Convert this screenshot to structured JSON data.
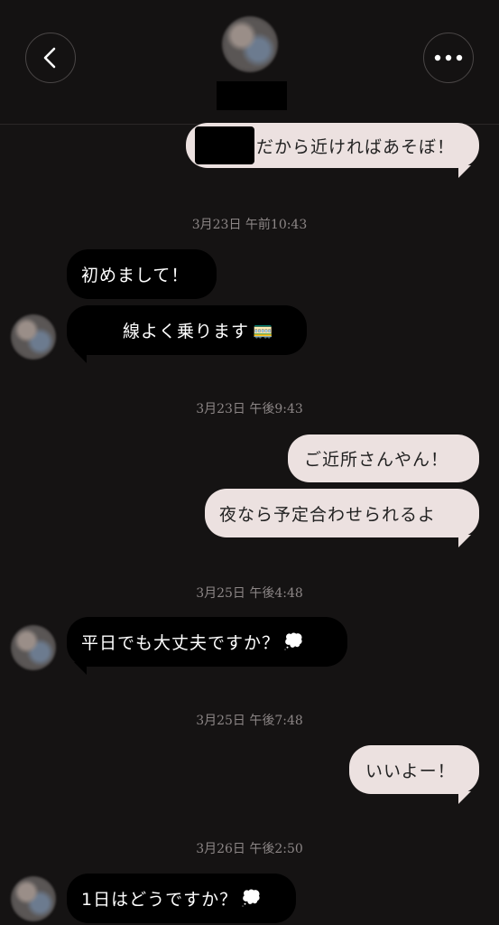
{
  "messages": {
    "m0": "だから近ければあそぼ！",
    "ts1": "3月23日 午前10:43",
    "m1": "初めまして！",
    "m2": "線よく乗ります",
    "ts2": "3月23日 午後9:43",
    "m3": "ご近所さんやん！",
    "m4": "夜なら予定合わせられるよ",
    "ts3": "3月25日 午後4:48",
    "m5": "平日でも大丈夫ですか？",
    "ts4": "3月25日 午後7:48",
    "m6": "いいよー！",
    "ts5": "3月26日 午後2:50",
    "m7": "1日はどうですか？"
  },
  "icons": {
    "train": "🚃",
    "thought": "💭"
  },
  "colors": {
    "background": "#151313",
    "incoming_bubble": "#000000",
    "outgoing_bubble": "#ece1e0",
    "timestamp": "#8c8686"
  }
}
